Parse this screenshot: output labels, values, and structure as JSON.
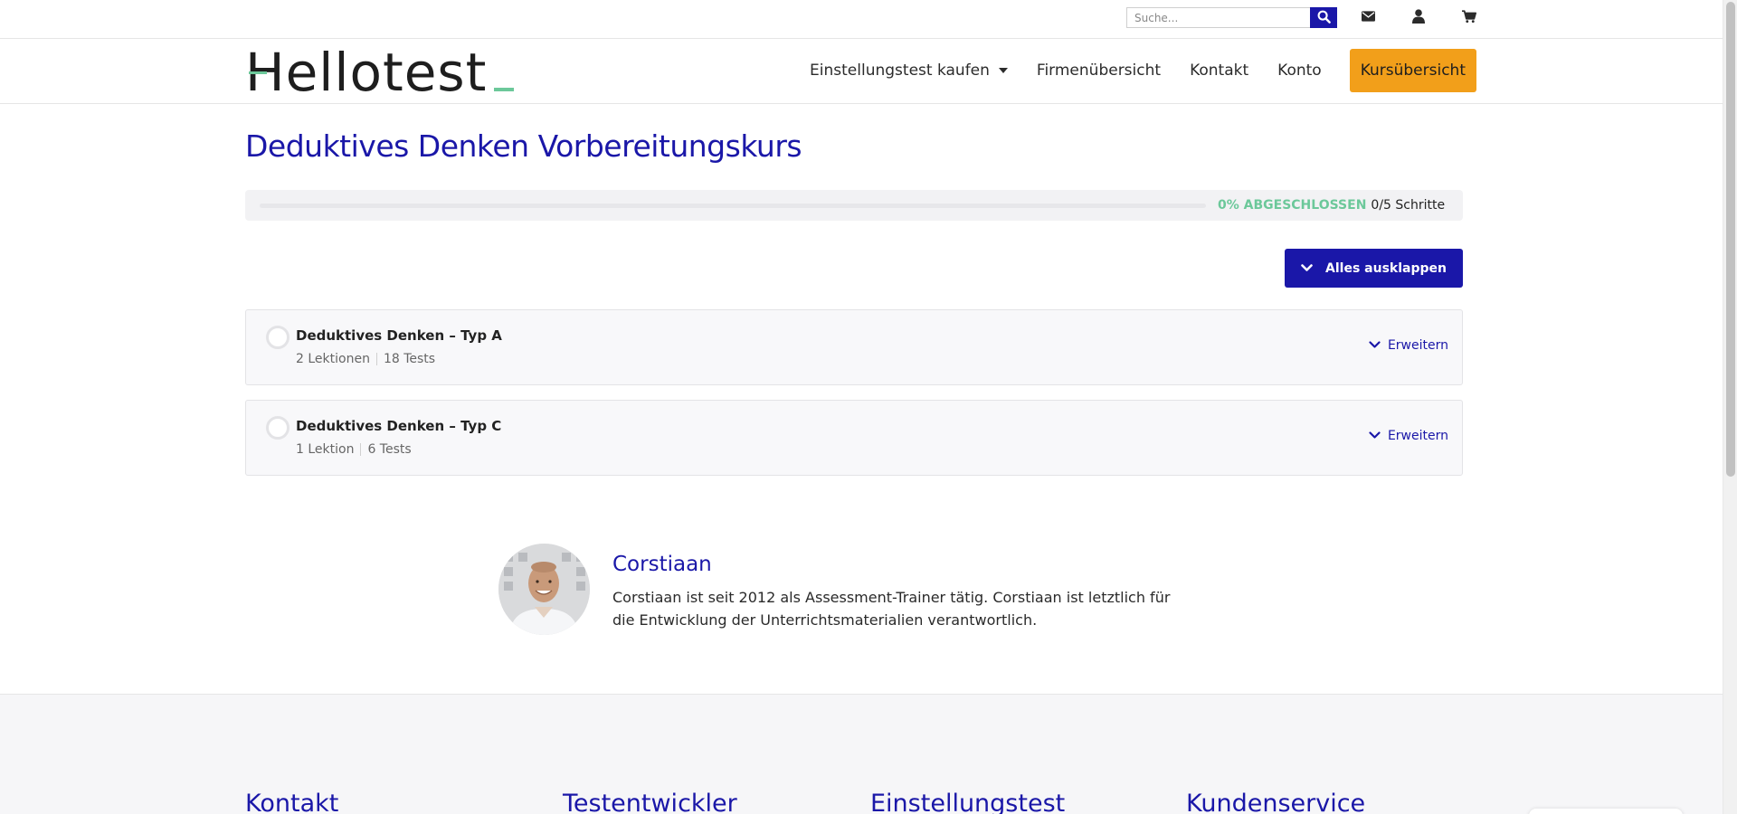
{
  "topbar": {
    "search_placeholder": "Suche...",
    "icons": [
      "search-icon",
      "mail-icon",
      "user-icon",
      "cart-icon"
    ]
  },
  "header": {
    "logo": "Hellotest",
    "nav": [
      {
        "label": "Einstellungstest kaufen",
        "has_dropdown": true
      },
      {
        "label": "Firmenübersicht"
      },
      {
        "label": "Kontakt"
      },
      {
        "label": "Konto"
      },
      {
        "label": "Kursübersicht"
      }
    ]
  },
  "course": {
    "title": "Deduktives Denken Vorbereitungskurs",
    "progress": {
      "percent_label": "0% ABGESCHLOSSEN",
      "steps_label": "0/5 Schritte",
      "fraction": 0
    },
    "expand_all_label": "Alles ausklappen",
    "sections": [
      {
        "title": "Deduktives Denken – Typ A",
        "lessons": "2 Lektionen",
        "tests": "18 Tests",
        "expand_label": "Erweitern"
      },
      {
        "title": "Deduktives Denken – Typ C",
        "lessons": "1 Lektion",
        "tests": "6 Tests",
        "expand_label": "Erweitern"
      }
    ]
  },
  "author": {
    "name": "Corstiaan",
    "bio": "Corstiaan ist seit 2012 als Assessment-Trainer tätig. Corstiaan ist letztlich für die Entwicklung der Unterrichtsmaterialien verantwortlich."
  },
  "footer": {
    "columns": [
      "Kontakt",
      "Testentwickler",
      "Einstellungstest",
      "Kundenservice"
    ]
  },
  "colors": {
    "brand_blue": "#1a17a8",
    "accent_green": "#6cc89a",
    "cta_orange": "#f29f1a"
  }
}
